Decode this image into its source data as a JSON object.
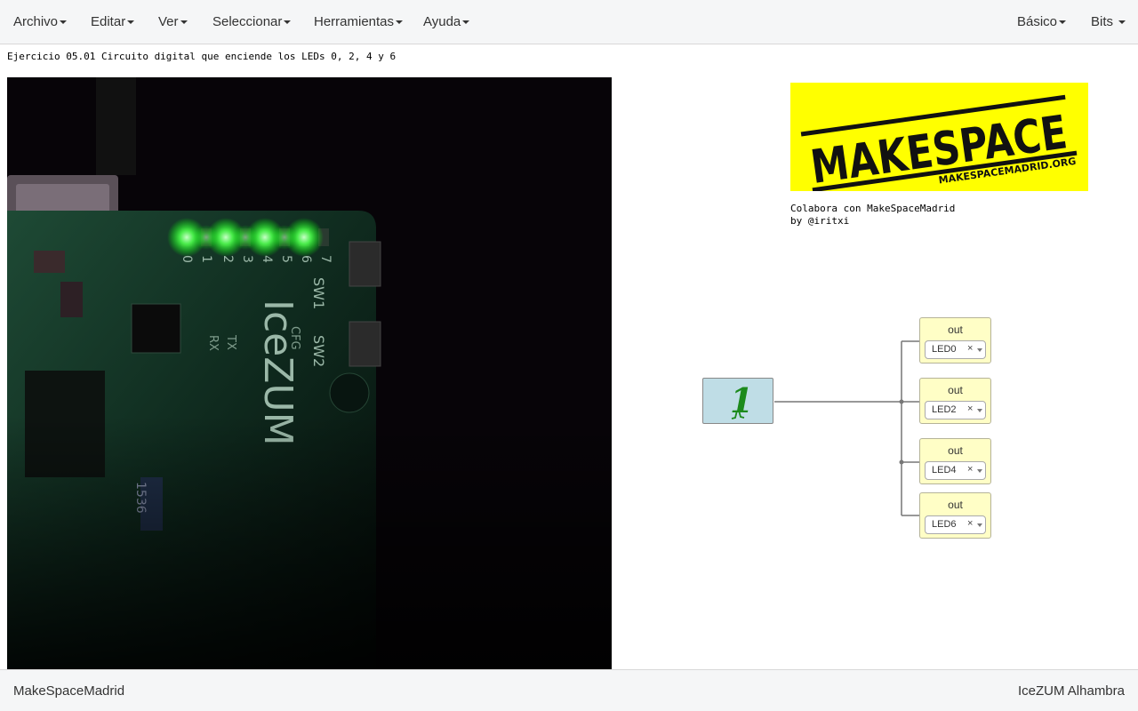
{
  "menubar": {
    "left": [
      {
        "label": "Archivo"
      },
      {
        "label": "Editar"
      },
      {
        "label": "Ver"
      },
      {
        "label": "Seleccionar"
      },
      {
        "label": "Herramientas"
      },
      {
        "label": "Ayuda"
      }
    ],
    "right": [
      {
        "label": "Básico"
      },
      {
        "label": "Bits"
      }
    ]
  },
  "canvas": {
    "description": "Ejercicio 05.01 Circuito digital que enciende los LEDs 0, 2, 4 y 6",
    "photo": {
      "board_label": "IceZUM",
      "led_numbers": [
        "0",
        "1",
        "2",
        "3",
        "4",
        "5",
        "6",
        "7"
      ],
      "switch_labels": [
        "SW1",
        "SW2"
      ],
      "other_labels": [
        "CFG",
        "TX",
        "RX",
        "1536"
      ]
    },
    "logo": {
      "text": "MAKESPACE",
      "subtext": "MAKESPACEMADRID.ORG"
    },
    "credits": {
      "line1": "Colabora con MakeSpaceMadrid",
      "line2": "by @iritxi"
    },
    "constant_block": {
      "value": "1"
    },
    "outputs": [
      {
        "title": "out",
        "pin": "LED0"
      },
      {
        "title": "out",
        "pin": "LED2"
      },
      {
        "title": "out",
        "pin": "LED4"
      },
      {
        "title": "out",
        "pin": "LED6"
      }
    ]
  },
  "footer": {
    "left": "MakeSpaceMadrid",
    "right": "IceZUM Alhambra"
  },
  "colors": {
    "menubar_bg": "#f5f6f7",
    "const_block_bg": "#bfdde6",
    "out_block_bg": "#fffec6",
    "logo_bg": "#ffff00",
    "led_on": "#5cff5c",
    "constant_glyph": "#1c8a1c"
  }
}
